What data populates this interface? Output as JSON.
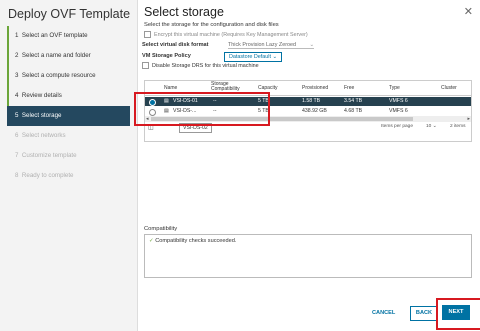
{
  "wizard": {
    "title": "Deploy OVF Template",
    "steps": [
      {
        "num": "1",
        "label": "Select an OVF template"
      },
      {
        "num": "2",
        "label": "Select a name and folder"
      },
      {
        "num": "3",
        "label": "Select a compute resource"
      },
      {
        "num": "4",
        "label": "Review details"
      },
      {
        "num": "5",
        "label": "Select storage"
      },
      {
        "num": "6",
        "label": "Select networks"
      },
      {
        "num": "7",
        "label": "Customize template"
      },
      {
        "num": "8",
        "label": "Ready to complete"
      }
    ]
  },
  "page": {
    "title": "Select storage",
    "subtitle": "Select the storage for the configuration and disk files",
    "encrypt_label": "Encrypt this virtual machine (Requires Key Management Server)",
    "disk_format_label": "Select virtual disk format",
    "disk_format_value": "Thick Provision Lazy Zeroed",
    "policy_label": "VM Storage Policy",
    "policy_value": "Datastore Default",
    "drs_label": "Disable Storage DRS for this virtual machine"
  },
  "table": {
    "headers": {
      "name": "Name",
      "compat": "Storage Compatibility",
      "capacity": "Capacity",
      "provisioned": "Provisioned",
      "free": "Free",
      "type": "Type",
      "cluster": "Cluster"
    },
    "rows": [
      {
        "name": "VSI-DS-01",
        "compat": "--",
        "capacity": "5 TB",
        "provisioned": "1.58 TB",
        "free": "3.54 TB",
        "type": "VMFS 6",
        "cluster": ""
      },
      {
        "name": "VSI-DS-...",
        "compat": "--",
        "capacity": "5 TB",
        "provisioned": "438.92 GB",
        "free": "4.68 TB",
        "type": "VMFS 6",
        "cluster": ""
      }
    ],
    "items_per_page_label": "Items per page",
    "items_per_page_value": "10",
    "item_count": "2 items",
    "tooltip": "VSI-DS-02"
  },
  "compatibility": {
    "label": "Compatibility",
    "message": "Compatibility checks succeeded."
  },
  "buttons": {
    "cancel": "CANCEL",
    "back": "BACK",
    "next": "NEXT"
  },
  "colors": {
    "accent": "#0072a3",
    "active_step": "#24485f",
    "selected_row": "#26414f",
    "highlight": "#d71920",
    "success": "#6ba539"
  }
}
